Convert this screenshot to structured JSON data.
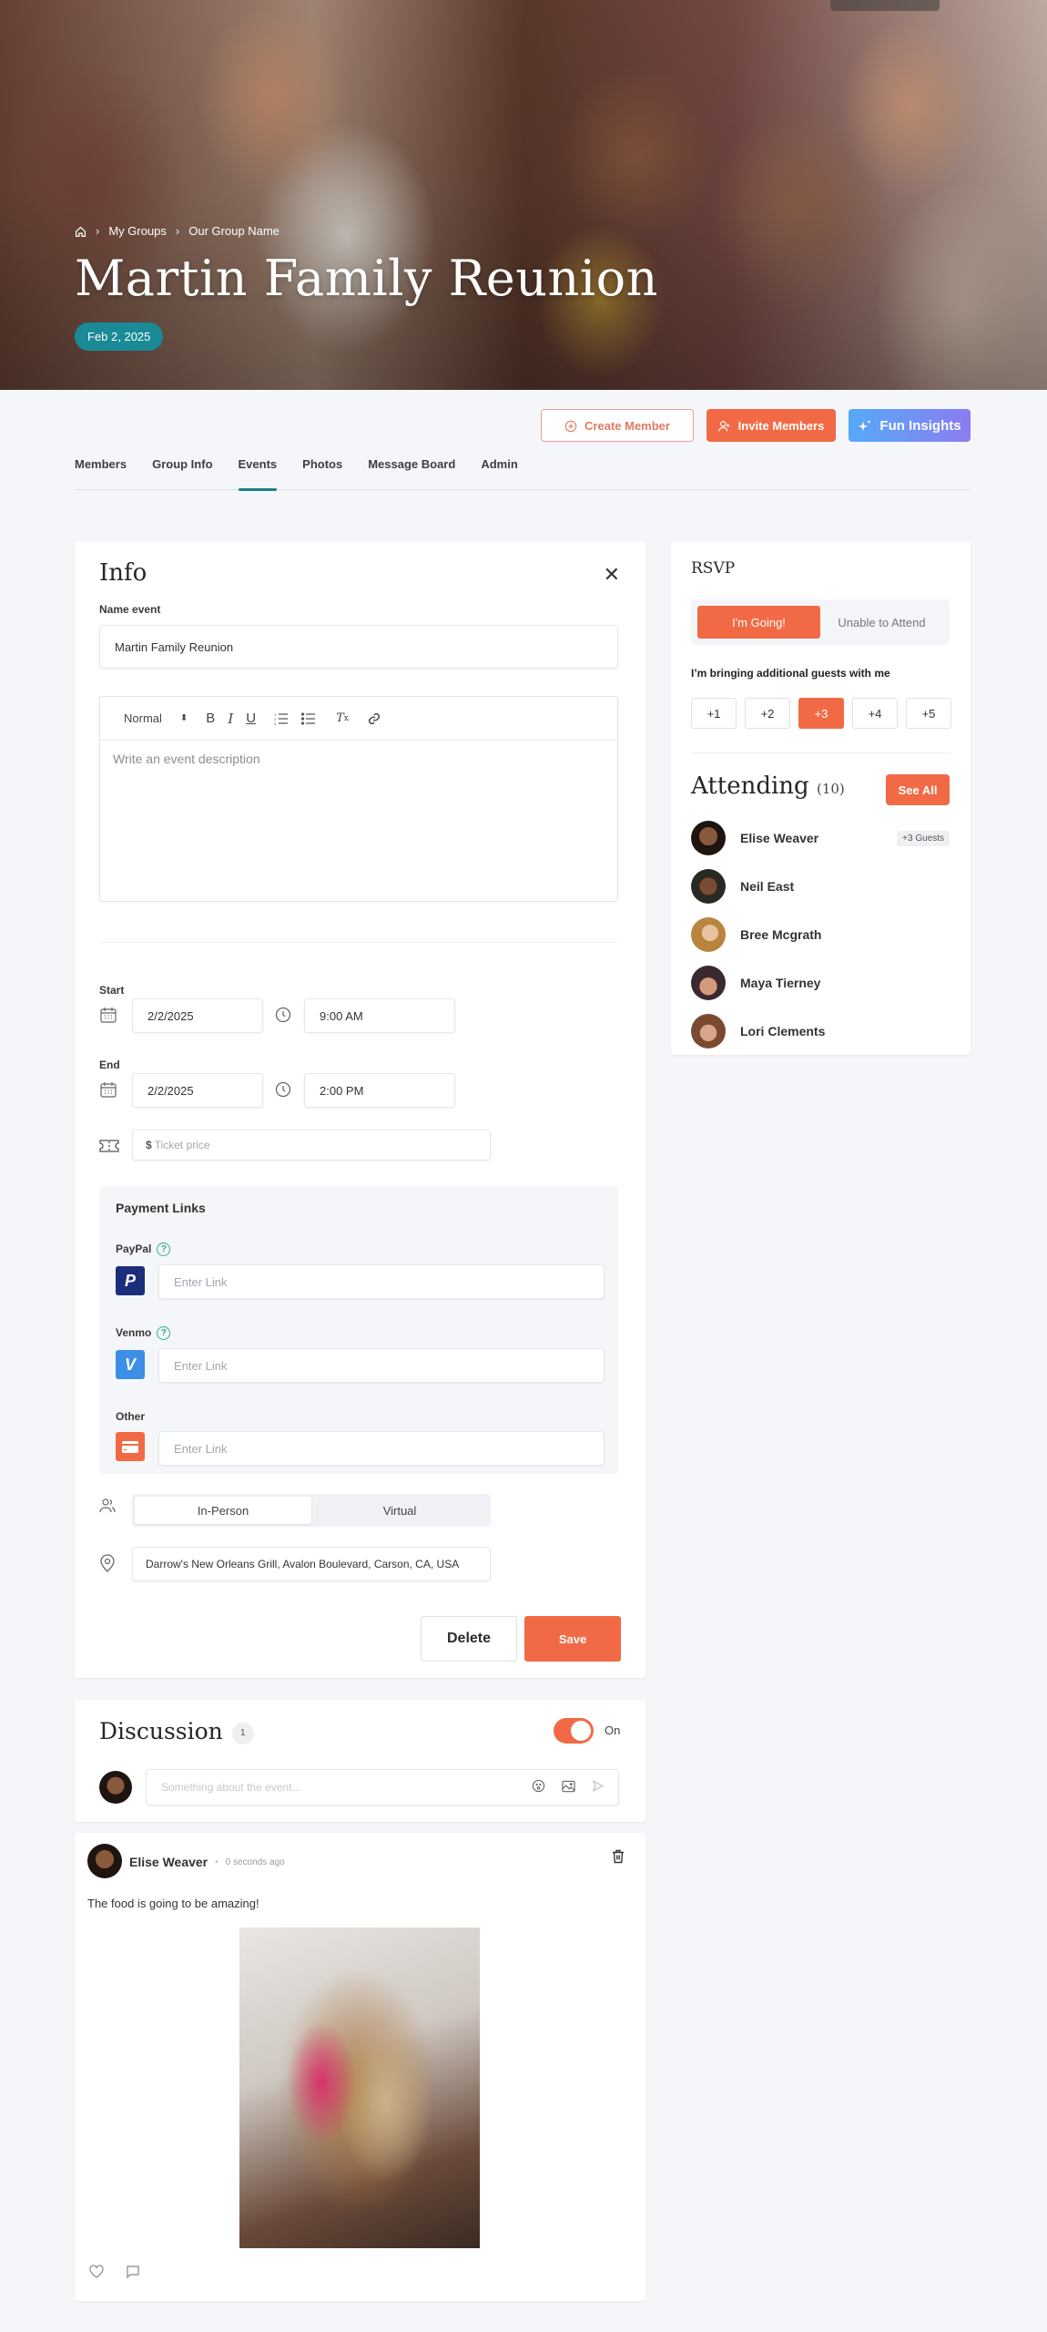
{
  "hero": {
    "breadcrumb": [
      "My Groups",
      "Our Group Name"
    ],
    "title": "Martin Family Reunion",
    "date": "Feb 2, 2025"
  },
  "actions": {
    "create_member": "Create Member",
    "invite_members": "Invite Members",
    "fun_insights": "Fun Insights"
  },
  "tabs": [
    {
      "label": "Members",
      "active": false
    },
    {
      "label": "Group Info",
      "active": false
    },
    {
      "label": "Events",
      "active": true
    },
    {
      "label": "Photos",
      "active": false
    },
    {
      "label": "Message Board",
      "active": false
    },
    {
      "label": "Admin",
      "active": false
    }
  ],
  "info": {
    "title": "Info",
    "name_label": "Name event",
    "name_value": "Martin Family Reunion",
    "editor": {
      "format": "Normal",
      "placeholder": "Write an event description"
    },
    "start_label": "Start",
    "start_date": "2/2/2025",
    "start_time": "9:00 AM",
    "end_label": "End",
    "end_date": "2/2/2025",
    "end_time": "2:00 PM",
    "ticket_prefix": "$",
    "ticket_placeholder": "Ticket price",
    "payment": {
      "title": "Payment Links",
      "items": [
        {
          "label": "PayPal",
          "placeholder": "Enter Link",
          "help": true
        },
        {
          "label": "Venmo",
          "placeholder": "Enter Link",
          "help": true
        },
        {
          "label": "Other",
          "placeholder": "Enter Link",
          "help": false
        }
      ]
    },
    "mode_options": [
      "In-Person",
      "Virtual"
    ],
    "mode_selected": "In-Person",
    "location": "Darrow's New Orleans Grill, Avalon Boulevard, Carson, CA, USA",
    "delete_label": "Delete",
    "save_label": "Save"
  },
  "rsvp": {
    "title": "RSVP",
    "going": "I'm Going!",
    "unable": "Unable to Attend",
    "selected": "I'm Going!",
    "guests_label": "I’m bringing additional guests with me",
    "guest_options": [
      "+1",
      "+2",
      "+3",
      "+4",
      "+5"
    ],
    "guest_selected": "+3",
    "attending_title": "Attending",
    "attending_count": "(10)",
    "see_all": "See All",
    "attendees": [
      {
        "name": "Elise Weaver",
        "badge": "+3 Guests"
      },
      {
        "name": "Neil East",
        "badge": ""
      },
      {
        "name": "Bree Mcgrath",
        "badge": ""
      },
      {
        "name": "Maya Tierney",
        "badge": ""
      },
      {
        "name": "Lori Clements",
        "badge": ""
      }
    ]
  },
  "discussion": {
    "title": "Discussion",
    "count": "1",
    "toggle_label": "On",
    "toggle_on": true,
    "input_placeholder": "Something about the event..."
  },
  "post": {
    "author": "Elise Weaver",
    "time": "0 seconds ago",
    "text": "The food is going to be amazing!"
  },
  "colors": {
    "accent_orange": "#f26a45",
    "teal": "#1a8a97",
    "tab_underline": "#1a7f87",
    "paypal": "#1b2e7a",
    "venmo": "#3d8fe6"
  }
}
